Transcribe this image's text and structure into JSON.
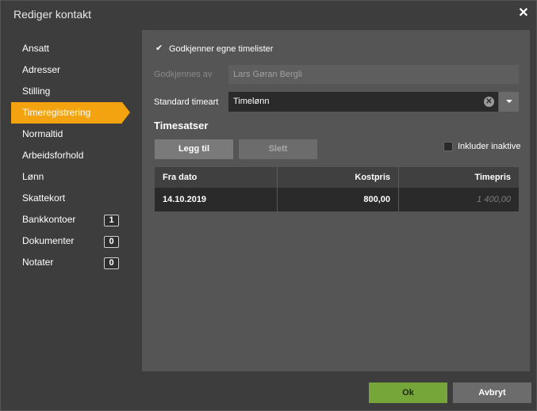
{
  "dialog": {
    "title": "Rediger kontakt"
  },
  "sidebar": {
    "items": [
      {
        "label": "Ansatt"
      },
      {
        "label": "Adresser"
      },
      {
        "label": "Stilling"
      },
      {
        "label": "Timeregistrering",
        "active": true
      },
      {
        "label": "Normaltid"
      },
      {
        "label": "Arbeidsforhold"
      },
      {
        "label": "Lønn"
      },
      {
        "label": "Skattekort"
      },
      {
        "label": "Bankkontoer",
        "badge": "1"
      },
      {
        "label": "Dokumenter",
        "badge": "0"
      },
      {
        "label": "Notater",
        "badge": "0"
      }
    ]
  },
  "form": {
    "approve_own_label": "Godkjenner egne timelister",
    "approve_own_checked": true,
    "approved_by_label": "Godkjennes av",
    "approved_by_value": "Lars Gøran Bergli",
    "standard_type_label": "Standard timeart",
    "standard_type_value": "Timelønn"
  },
  "rates": {
    "title": "Timesatser",
    "add_label": "Legg til",
    "delete_label": "Slett",
    "include_inactive_label": "Inkluder inaktive",
    "include_inactive_checked": false,
    "columns": [
      "Fra dato",
      "Kostpris",
      "Timepris"
    ],
    "rows": [
      {
        "from_date": "14.10.2019",
        "cost_price": "800,00",
        "hour_price": "1 400,00"
      }
    ]
  },
  "footer": {
    "ok_label": "Ok",
    "cancel_label": "Avbryt"
  },
  "colors": {
    "accent": "#f2a30f",
    "ok": "#76a53a",
    "panel": "#555555",
    "background": "#3d3d3d"
  },
  "icons": {
    "close": "close-icon",
    "check": "check-icon",
    "clear": "clear-icon",
    "dropdown": "chevron-down-icon"
  }
}
